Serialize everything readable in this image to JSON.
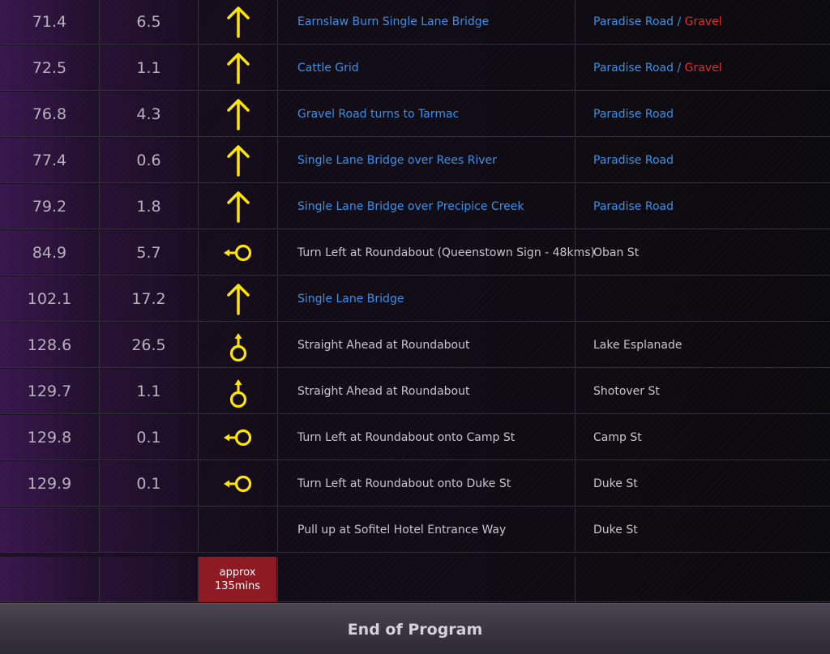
{
  "rows": [
    {
      "total": "71.4",
      "leg": "6.5",
      "icon": "arrow-up-icon",
      "desc": "Earnslaw Burn Single Lane Bridge",
      "desc_color": "blue",
      "road": "Paradise Road",
      "road_sep": " / ",
      "road_extra": "Gravel"
    },
    {
      "total": "72.5",
      "leg": "1.1",
      "icon": "arrow-up-icon",
      "desc": "Cattle Grid",
      "desc_color": "blue",
      "road": "Paradise Road",
      "road_sep": " / ",
      "road_extra": "Gravel"
    },
    {
      "total": "76.8",
      "leg": "4.3",
      "icon": "arrow-up-icon",
      "desc": "Gravel Road turns to Tarmac",
      "desc_color": "blue",
      "road": "Paradise Road"
    },
    {
      "total": "77.4",
      "leg": "0.6",
      "icon": "arrow-up-icon",
      "desc": "Single Lane Bridge over Rees River",
      "desc_color": "blue",
      "road": "Paradise Road"
    },
    {
      "total": "79.2",
      "leg": "1.8",
      "icon": "arrow-up-icon",
      "desc": "Single Lane Bridge over Precipice Creek",
      "desc_color": "blue",
      "road": "Paradise Road"
    },
    {
      "total": "84.9",
      "leg": "5.7",
      "icon": "roundabout-left-icon",
      "desc": "Turn Left at Roundabout (Queenstown Sign - 48kms)",
      "desc_color": "white",
      "road": "Oban St"
    },
    {
      "total": "102.1",
      "leg": "17.2",
      "icon": "arrow-up-icon",
      "desc": "Single Lane Bridge",
      "desc_color": "blue",
      "road": ""
    },
    {
      "total": "128.6",
      "leg": "26.5",
      "icon": "roundabout-straight-icon",
      "desc": "Straight Ahead at Roundabout",
      "desc_color": "white",
      "road": "Lake Esplanade"
    },
    {
      "total": "129.7",
      "leg": "1.1",
      "icon": "roundabout-straight-icon",
      "desc": "Straight Ahead at Roundabout",
      "desc_color": "white",
      "road": "Shotover St"
    },
    {
      "total": "129.8",
      "leg": "0.1",
      "icon": "roundabout-left-icon",
      "desc": "Turn Left at Roundabout onto Camp St",
      "desc_color": "white",
      "road": "Camp St"
    },
    {
      "total": "129.9",
      "leg": "0.1",
      "icon": "roundabout-left-icon",
      "desc": "Turn Left at Roundabout onto Duke St",
      "desc_color": "white",
      "road": "Duke St"
    },
    {
      "total": "",
      "leg": "",
      "icon": "",
      "desc": "Pull up at Sofitel Hotel Entrance Way",
      "desc_color": "white",
      "road": "Duke St"
    }
  ],
  "duration": {
    "line1": "approx",
    "line2": "135mins"
  },
  "colors": {
    "blue": "#3d8fe6",
    "red": "#e22b2b",
    "icon_yellow": "#ffe500",
    "badge": "#8e1a23"
  },
  "footer": {
    "label": "End of Program"
  }
}
